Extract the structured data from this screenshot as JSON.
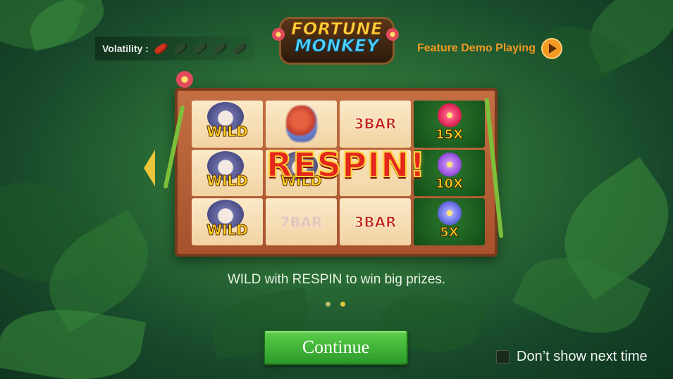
{
  "header": {
    "volatility_label": "Volatility :",
    "volatility_level": 1,
    "volatility_max": 5,
    "logo_line1": "FORTUNE",
    "logo_line2": "MONKEY",
    "feature_text": "Feature Demo Playing"
  },
  "reels": {
    "col1": [
      "WILD",
      "WILD",
      "WILD"
    ],
    "col2_symbols": [
      "parrot",
      "WILD",
      "7BAR"
    ],
    "col2_center_label": "WILD",
    "col2_bottom_label": "7BAR",
    "col3": [
      "3BAR",
      "",
      "3BAR"
    ],
    "col4": [
      "15X",
      "10X",
      "5X"
    ],
    "banner": "RESPIN!"
  },
  "description": "WILD with RESPIN to win big prizes.",
  "pager": {
    "pages": 2,
    "active": 2
  },
  "continue_label": "Continue",
  "dont_show_label": "Don’t show next time",
  "colors": {
    "accent_orange": "#f29a22",
    "button_green": "#3fb83a",
    "respin_red": "#e5261b"
  }
}
